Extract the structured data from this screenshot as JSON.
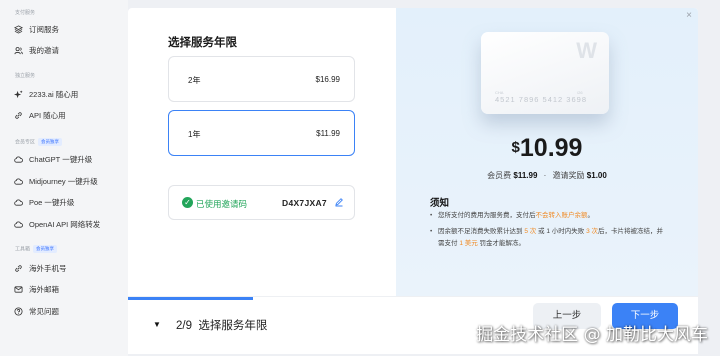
{
  "sidebar": {
    "sections": [
      {
        "title": "支付服务",
        "items": [
          {
            "label": "订阅服务",
            "icon": "layers-icon"
          },
          {
            "label": "我的邀请",
            "icon": "users-icon"
          }
        ]
      },
      {
        "title": "独立服务",
        "items": [
          {
            "label": "2233.ai 随心用",
            "icon": "sparkle-icon"
          },
          {
            "label": "API 随心用",
            "icon": "link-icon"
          }
        ]
      },
      {
        "title": "会员专区",
        "tag": "会员独享",
        "items": [
          {
            "label": "ChatGPT 一键升级",
            "icon": "cloud-icon"
          },
          {
            "label": "Midjourney 一键升级",
            "icon": "cloud-icon"
          },
          {
            "label": "Poe 一键升级",
            "icon": "cloud-icon"
          },
          {
            "label": "OpenAI API 网络转发",
            "icon": "cloud-icon"
          }
        ]
      },
      {
        "title": "工具箱",
        "tag": "会员独享",
        "items": [
          {
            "label": "海外手机号",
            "icon": "link-icon"
          },
          {
            "label": "海外邮箱",
            "icon": "mail-icon"
          },
          {
            "label": "常见问题",
            "icon": "help-icon"
          }
        ]
      }
    ]
  },
  "modal": {
    "title": "选择服务年限",
    "plans": [
      {
        "label": "2年",
        "price": "$16.99",
        "selected": false
      },
      {
        "label": "1年",
        "price": "$11.99",
        "selected": true
      }
    ],
    "invite": {
      "status": "已使用邀请码",
      "code": "D4X7JXA7"
    },
    "card": {
      "brand_letter": "W",
      "name_caption": "CHA",
      "expiry_caption": "/26",
      "number": "4521  7896  5412  3698"
    },
    "price_big": "10.99",
    "price_currency": "$",
    "fee_label": "会员费",
    "fee_value": "$11.99",
    "fee_sep": "·",
    "reward_label": "邀请奖励",
    "reward_value": "$1.00",
    "notice_title": "须知",
    "notice_1_pre": "您所支付的费用为服务费，支付后",
    "notice_1_hl": "不会转入账户余额",
    "notice_1_post": "。",
    "notice_2_a": "因余额不足消费失败累计达到",
    "notice_2_b": "5 次",
    "notice_2_c": "或 1 小时内失败",
    "notice_2_d": "3 次",
    "notice_2_e": "后，卡片将被冻结，并需支付",
    "notice_2_f": "1 美元",
    "notice_2_g": "罚金才能解冻。",
    "close_symbol": "×"
  },
  "footer": {
    "progress_fraction": 0.22,
    "step_count": "2/9",
    "step_label": "选择服务年限",
    "prev_label": "上一步",
    "next_label": "下一步"
  },
  "watermark": "掘金技术社区 @ 加勒比大风车"
}
